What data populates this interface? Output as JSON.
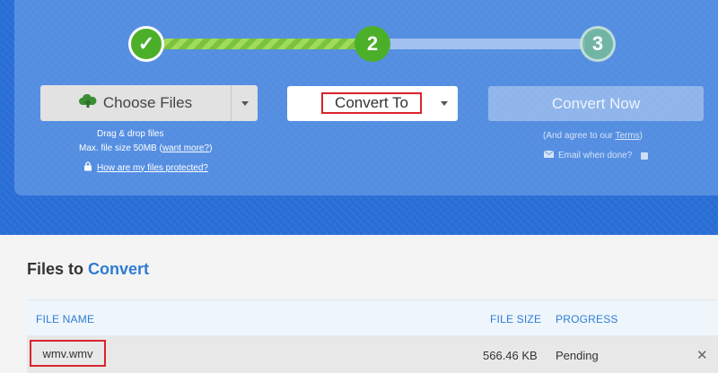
{
  "stepper": {
    "step1": "✓",
    "step2": "2",
    "step3": "3"
  },
  "upload": {
    "choose_label": "Choose Files",
    "drag_text": "Drag & drop files",
    "max_size_text": "Max. file size 50MB (",
    "want_more_link": "want more?",
    "max_size_close": ")",
    "protected_link": "How are my files protected?"
  },
  "convert_to": {
    "label": "Convert To"
  },
  "convert_now": {
    "label": "Convert Now",
    "agree_prefix": "(And agree to our ",
    "terms_link": "Terms",
    "agree_suffix": ")",
    "email_label": "Email when done?"
  },
  "files": {
    "title_prefix": "Files to ",
    "title_accent": "Convert",
    "columns": {
      "name": "FILE NAME",
      "size": "FILE SIZE",
      "progress": "PROGRESS"
    },
    "rows": [
      {
        "name": "wmv.wmv",
        "size": "566.46 KB",
        "status": "Pending",
        "remove": "✕"
      }
    ]
  },
  "colors": {
    "hero_blue": "#2a6fd8",
    "step_green": "#4caf2a",
    "accent_blue": "#2f7cd3",
    "highlight_red": "#d9232d"
  }
}
